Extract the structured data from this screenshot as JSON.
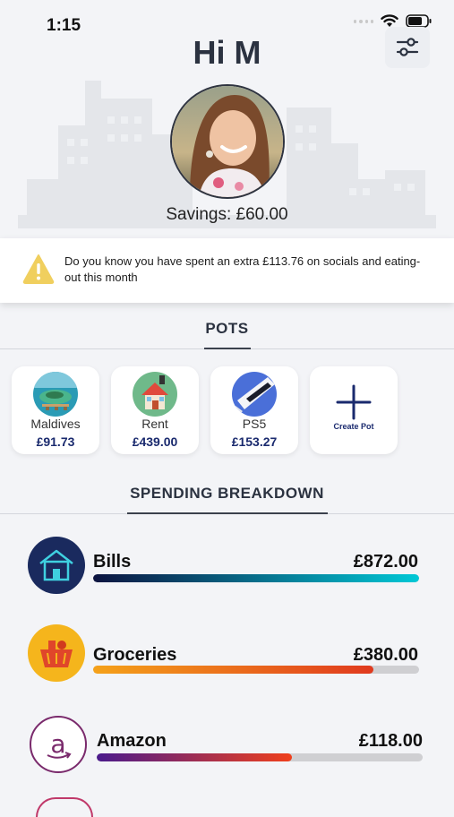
{
  "status_bar": {
    "time": "1:15"
  },
  "header": {
    "greeting": "Hi M",
    "savings": "Savings: £60.00"
  },
  "alert": {
    "message": "Do you know you have spent an extra £113.76 on socials and eating-out this month"
  },
  "pots": {
    "title": "POTS",
    "items": [
      {
        "name": "Maldives",
        "amount": "£91.73"
      },
      {
        "name": "Rent",
        "amount": "£439.00"
      },
      {
        "name": "PS5",
        "amount": "£153.27"
      }
    ],
    "create_label": "Create Pot"
  },
  "spending": {
    "title": "SPENDING BREAKDOWN",
    "items": [
      {
        "name": "Bills",
        "amount": "£872.00",
        "fill_fraction": 1.0,
        "colors": [
          "#0d1440",
          "#00c8d6"
        ]
      },
      {
        "name": "Groceries",
        "amount": "£380.00",
        "fill_fraction": 0.86,
        "colors": [
          "#f5a21a",
          "#e03a1e"
        ]
      },
      {
        "name": "Amazon",
        "amount": "£118.00",
        "fill_fraction": 0.6,
        "colors": [
          "#4a1a8c",
          "#f0401c"
        ]
      }
    ]
  }
}
